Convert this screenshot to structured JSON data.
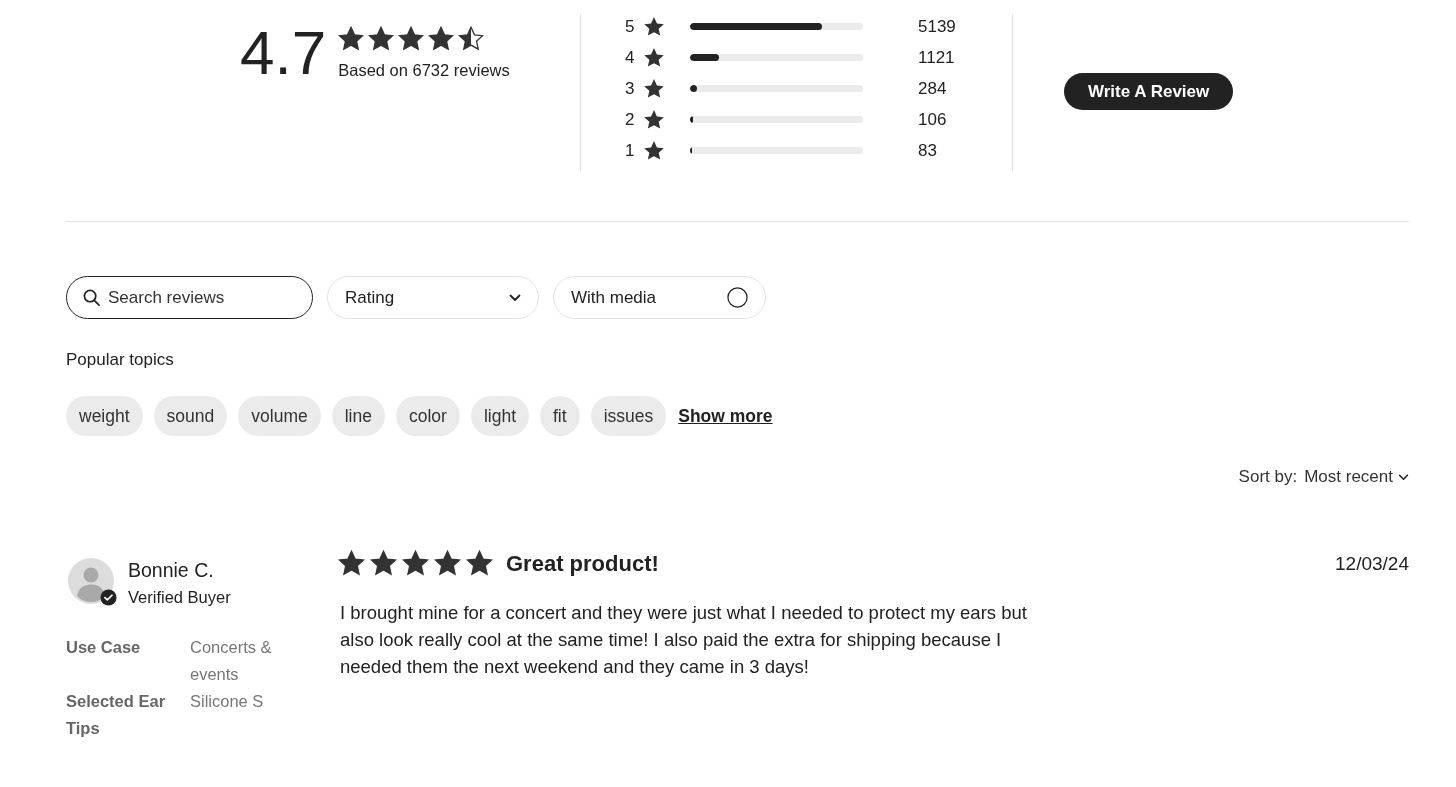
{
  "summary": {
    "average": "4.7",
    "stars": 4.5,
    "based_on": "Based on 6732 reviews"
  },
  "breakdown": [
    {
      "label": "5",
      "level": 0.763,
      "count": "5139"
    },
    {
      "label": "4",
      "level": 0.167,
      "count": "1121"
    },
    {
      "label": "3",
      "level": 0.042,
      "count": "284"
    },
    {
      "label": "2",
      "level": 0.016,
      "count": "106"
    },
    {
      "label": "1",
      "level": 0.012,
      "count": "83"
    }
  ],
  "write_review_button": "Write A Review",
  "filters": {
    "search": {
      "placeholder": "Search reviews"
    },
    "rating": {
      "label": "Rating"
    },
    "with_media": {
      "label": "With media",
      "checked": false
    }
  },
  "popular_topics": {
    "title": "Popular topics",
    "topics": [
      "weight",
      "sound",
      "volume",
      "line",
      "color",
      "light",
      "fit",
      "issues"
    ],
    "show_more": "Show more"
  },
  "sort": {
    "label": "Sort by:",
    "value": "Most recent"
  },
  "reviews": [
    {
      "author": "Bonnie C.",
      "verified": true,
      "badge": "Verified Buyer",
      "attributes": [
        {
          "label": "Use Case",
          "value": "Concerts & events"
        },
        {
          "label": "Selected Ear Tips",
          "value": "Silicone S"
        }
      ],
      "stars": 5,
      "title": "Great product!",
      "body": "I brought mine for a concert and they were just what I needed to protect my ears but also look really cool at the same time! I also paid the extra for shipping because I needed them the next weekend and they came in 3 days!",
      "date": "12/03/24"
    }
  ]
}
